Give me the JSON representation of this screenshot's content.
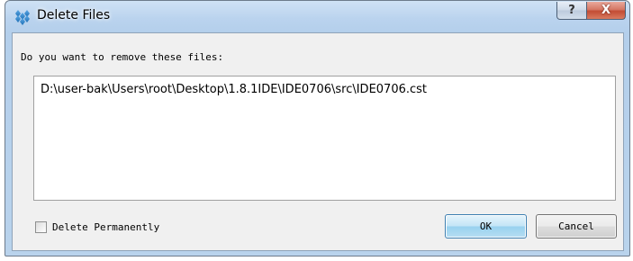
{
  "window": {
    "title": "Delete Files",
    "help_symbol": "?",
    "close_symbol": "X",
    "icon": "app-logo-icon"
  },
  "dialog": {
    "prompt": "Do you want to remove these files:",
    "files": [
      "D:\\user-bak\\Users\\root\\Desktop\\1.8.1IDE\\IDE0706\\src\\IDE0706.cst"
    ],
    "delete_permanently": {
      "label": "Delete Permanently",
      "checked": false
    },
    "ok_label": "OK",
    "cancel_label": "Cancel"
  },
  "colors": {
    "frame": "#b9d3ec",
    "client": "#f0f0f0",
    "close_button": "#c24c34",
    "default_button_border": "#3c7fb1"
  }
}
